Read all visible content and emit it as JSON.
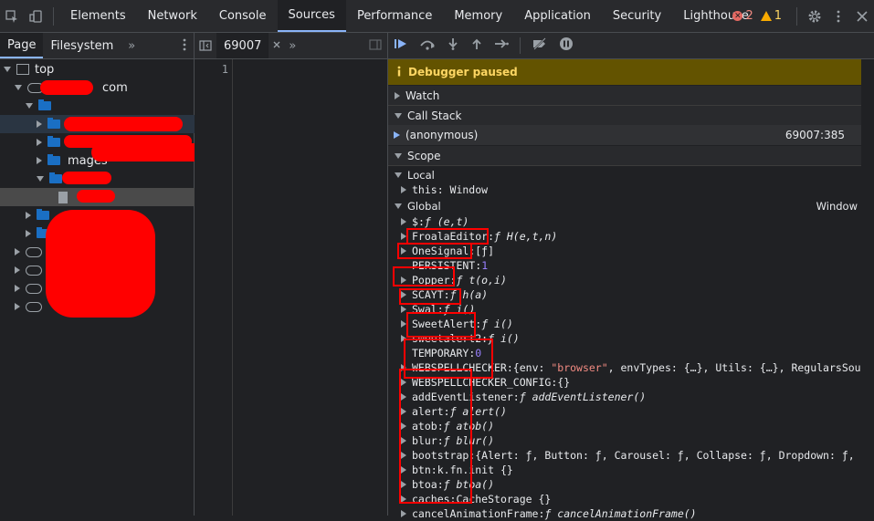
{
  "topbar": {
    "tabs": [
      "Elements",
      "Network",
      "Console",
      "Sources",
      "Performance",
      "Memory",
      "Application",
      "Security",
      "Lighthouse"
    ],
    "active_tab": "Sources",
    "error_count": "2",
    "warning_count": "1"
  },
  "navigator": {
    "tabs": [
      "Page",
      "Filesystem"
    ],
    "more": "»",
    "tree": [
      {
        "label": "top"
      },
      {
        "label": "com"
      },
      {
        "label": "mages"
      }
    ]
  },
  "editor": {
    "tab": "69007",
    "more": "»",
    "line": "1"
  },
  "debugger": {
    "banner": "Debugger paused",
    "watch": "Watch",
    "call_stack": "Call Stack",
    "frame_name": "(anonymous)",
    "frame_location": "69007:385",
    "scope": "Scope",
    "local": "Local",
    "this_row": "this: Window",
    "global": "Global",
    "global_value": "Window",
    "rows": [
      {
        "name": "$",
        "value": "ƒ (e,t)"
      },
      {
        "name": "FroalaEditor",
        "value": "ƒ H(e,t,n)"
      },
      {
        "name": "OneSignal",
        "value": "[ƒ]"
      },
      {
        "name": "PERSISTENT",
        "value": "1"
      },
      {
        "name": "Popper",
        "value": "ƒ t(o,i)"
      },
      {
        "name": "SCAYT",
        "value": "ƒ h(a)"
      },
      {
        "name": "Swal",
        "value": "ƒ i()"
      },
      {
        "name": "SweetAlert",
        "value": "ƒ i()"
      },
      {
        "name": "sweetalert2",
        "value": "ƒ i()"
      },
      {
        "name": "TEMPORARY",
        "value": "0"
      },
      {
        "name": "WEBSPELLCHECKER",
        "value": "{env: \"browser\", envTypes: {…}, Utils: {…}, RegularsSour…"
      },
      {
        "name": "WEBSPELLCHECKER_CONFIG",
        "value": "{}"
      },
      {
        "name": "addEventListener",
        "value": "ƒ addEventListener()"
      },
      {
        "name": "alert",
        "value": "ƒ alert()"
      },
      {
        "name": "atob",
        "value": "ƒ atob()"
      },
      {
        "name": "blur",
        "value": "ƒ blur()"
      },
      {
        "name": "bootstrap",
        "value": "{Alert: ƒ, Button: ƒ, Carousel: ƒ, Collapse: ƒ, Dropdown: ƒ, …}"
      },
      {
        "name": "btn",
        "value": "k.fn.init {}"
      },
      {
        "name": "btoa",
        "value": "ƒ btoa()"
      },
      {
        "name": "caches",
        "value": "CacheStorage {}"
      },
      {
        "name": "cancelAnimationFrame",
        "value": "ƒ cancelAnimationFrame()"
      }
    ]
  }
}
